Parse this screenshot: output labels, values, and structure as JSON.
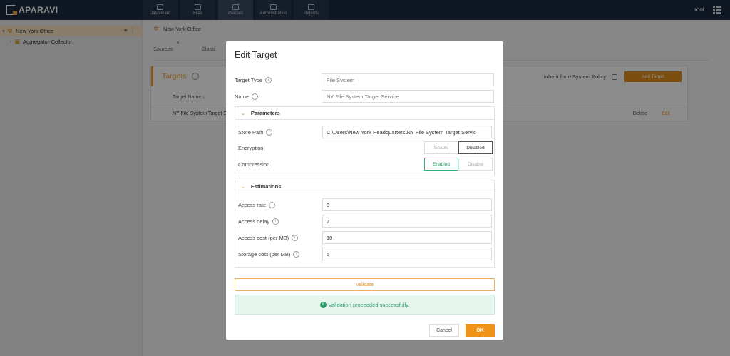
{
  "app": {
    "logo_text": "APARAVI",
    "nav": [
      {
        "label": "Dashboard"
      },
      {
        "label": "Files"
      },
      {
        "label": "Policies"
      },
      {
        "label": "Administration"
      },
      {
        "label": "Reports"
      }
    ],
    "user": "root"
  },
  "tree": {
    "items": [
      {
        "label": "New York Office",
        "selected": true
      },
      {
        "label": "Aggregator-Collector"
      }
    ],
    "actions": "★ ⋮"
  },
  "main": {
    "breadcrumb": "New York Office",
    "tabs": [
      "Sources",
      "Class"
    ],
    "targets_title": "Targets",
    "inherit_label": "Inherit from System Policy",
    "add_target_label": "Add Target",
    "column_name": "Target Name ↓",
    "row": {
      "name": "NY File System Target S",
      "delete": "Delete",
      "edit": "Edit"
    }
  },
  "modal": {
    "title": "Edit Target",
    "target_type_label": "Target Type",
    "target_type_placeholder": "File System",
    "name_label": "Name",
    "name_placeholder": "NY File System Target Service",
    "parameters": {
      "title": "Parameters",
      "store_path_label": "Store Path",
      "store_path_value": "C:\\Users\\New York Headquarters\\NY File System Target Servic",
      "encryption_label": "Encryption",
      "encryption_options": [
        "Enable",
        "Disabled"
      ],
      "compression_label": "Compression",
      "compression_options": [
        "Enabled",
        "Disable"
      ]
    },
    "estimations": {
      "title": "Estimations",
      "access_rate_label": "Access rate",
      "access_rate_value": "8",
      "access_delay_label": "Access delay",
      "access_delay_value": "7",
      "access_cost_label": "Access cost (per MB)",
      "access_cost_value": "10",
      "storage_cost_label": "Storage cost (per MB)",
      "storage_cost_value": "5"
    },
    "validate_label": "Validate",
    "success_message": "Validation proceeded successfully.",
    "cancel_label": "Cancel",
    "ok_label": "OK"
  },
  "colors": {
    "accent": "#e28f1c",
    "success": "#2a9e6b",
    "topbar": "#1d2b3e"
  }
}
